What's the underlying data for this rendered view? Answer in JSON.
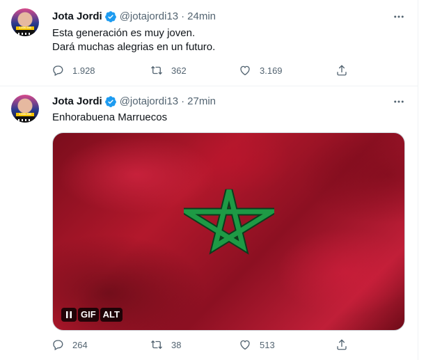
{
  "tweets": [
    {
      "name": "Jota Jordi",
      "handle": "@jotajordi13",
      "separator": "·",
      "time": "24min",
      "text_lines": [
        "Esta generación es muy joven.",
        "Dará muchas alegrias en un futuro."
      ],
      "avatar_text": "1.000.000",
      "stats": {
        "replies": "1.928",
        "retweets": "362",
        "likes": "3.169"
      }
    },
    {
      "name": "Jota Jordi",
      "handle": "@jotajordi13",
      "separator": "·",
      "time": "27min",
      "text_lines": [
        "Enhorabuena Marruecos"
      ],
      "avatar_text": "1.000.000",
      "media": {
        "gif_label": "GIF",
        "alt_label": "ALT"
      },
      "stats": {
        "replies": "264",
        "retweets": "38",
        "likes": "513"
      }
    }
  ],
  "icons": {
    "verified": "verified-badge-icon",
    "more": "more-icon",
    "reply": "reply-icon",
    "retweet": "retweet-icon",
    "like": "like-icon",
    "share": "share-icon",
    "pause": "pause-icon"
  },
  "colors": {
    "text": "#0f1419",
    "secondary": "#536471",
    "verified_blue": "#1d9bf0",
    "flag_red": "#c1272d",
    "star_green": "#006233",
    "border": "#eff3f4"
  }
}
